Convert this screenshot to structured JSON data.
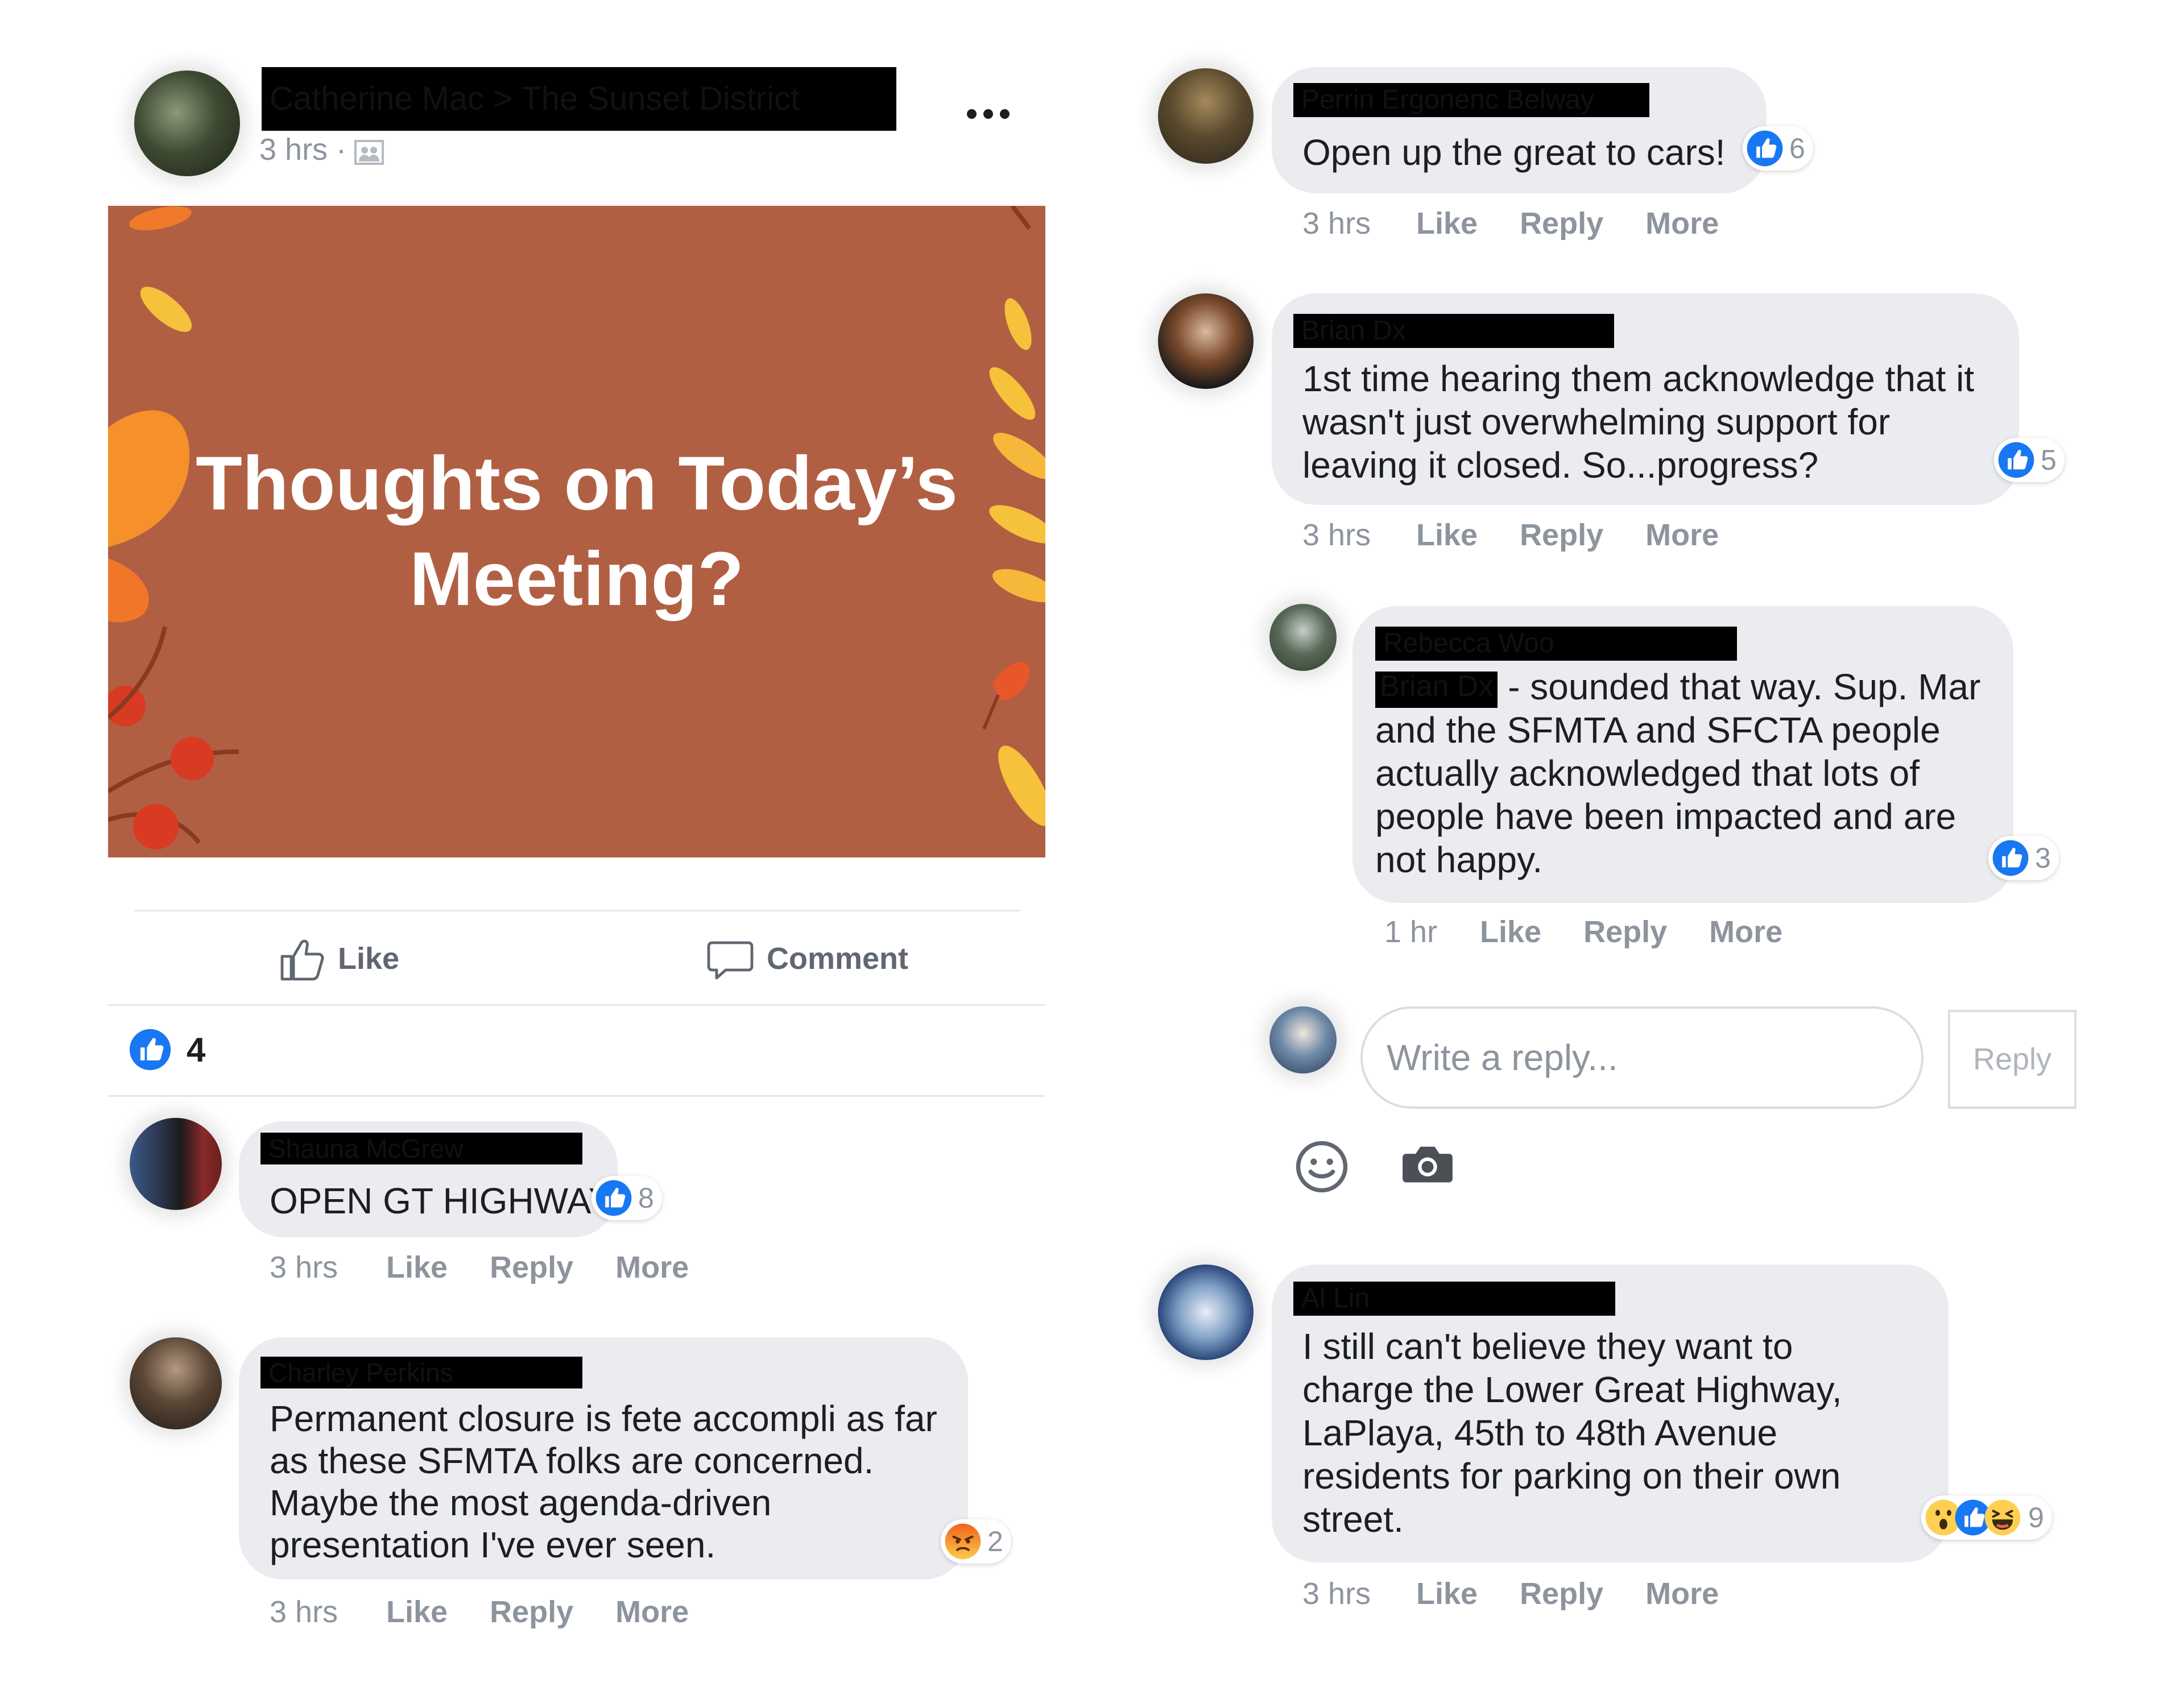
{
  "post": {
    "author_redacted": "Catherine Mac > The Sunset District",
    "time": "3 hrs ·",
    "privacy_icon": "group-icon",
    "more_icon": "more-horizontal-icon",
    "image_text": "Thoughts on Today’s\nMeeting?",
    "actions": {
      "like": "Like",
      "comment": "Comment"
    },
    "reaction_count": "4"
  },
  "comments": [
    {
      "author_redacted": "Shauna McGrew",
      "text": "OPEN GT HIGHWAY",
      "reaction_count": "8",
      "time": "3 hrs",
      "like": "Like",
      "reply": "Reply",
      "more": "More"
    },
    {
      "author_redacted": "Charley Perkins",
      "text": "Permanent closure is fete accompli as far as these SFMTA folks are concerned. Maybe the most agenda-driven presentation I've ever seen.",
      "reaction_count": "2",
      "time": "3 hrs",
      "like": "Like",
      "reply": "Reply",
      "more": "More"
    },
    {
      "author_redacted": "Perrin Ergonenc Belway",
      "text": "Open up the great to cars!",
      "reaction_count": "6",
      "time": "3 hrs",
      "like": "Like",
      "reply": "Reply",
      "more": "More"
    },
    {
      "author_redacted": "Brian Dx",
      "text": "1st time hearing them acknowledge that it wasn't just overwhelming support for leaving it closed. So...progress?",
      "reaction_count": "5",
      "time": "3 hrs",
      "like": "Like",
      "reply": "Reply",
      "more": "More"
    },
    {
      "author_redacted": "Rebecca Woo",
      "mention_redacted": "Brian Dx",
      "text_first_line": " - sounded that way. Sup.",
      "text_rest": "Mar and the SFMTA and SFCTA people actually acknowledged that lots of people have been impacted and are not happy.",
      "reaction_count": "3",
      "time": "1 hr",
      "like": "Like",
      "reply": "Reply",
      "more": "More"
    },
    {
      "author_redacted": "Al Lin",
      "text": "I still can't believe they want to charge the Lower Great Highway, LaPlaya, 45th to 48th Avenue residents for parking on their own street.",
      "reaction_count": "9",
      "time": "3 hrs",
      "like": "Like",
      "reply": "Reply",
      "more": "More"
    }
  ],
  "reply_box": {
    "placeholder": "Write a reply...",
    "button": "Reply",
    "emoji_icon": "smiley-icon",
    "camera_icon": "camera-icon"
  },
  "colors": {
    "image_bg": "#b15f43",
    "like_blue": "#1877f2",
    "bubble": "#eaecef",
    "meta_gray": "#8d949e"
  }
}
